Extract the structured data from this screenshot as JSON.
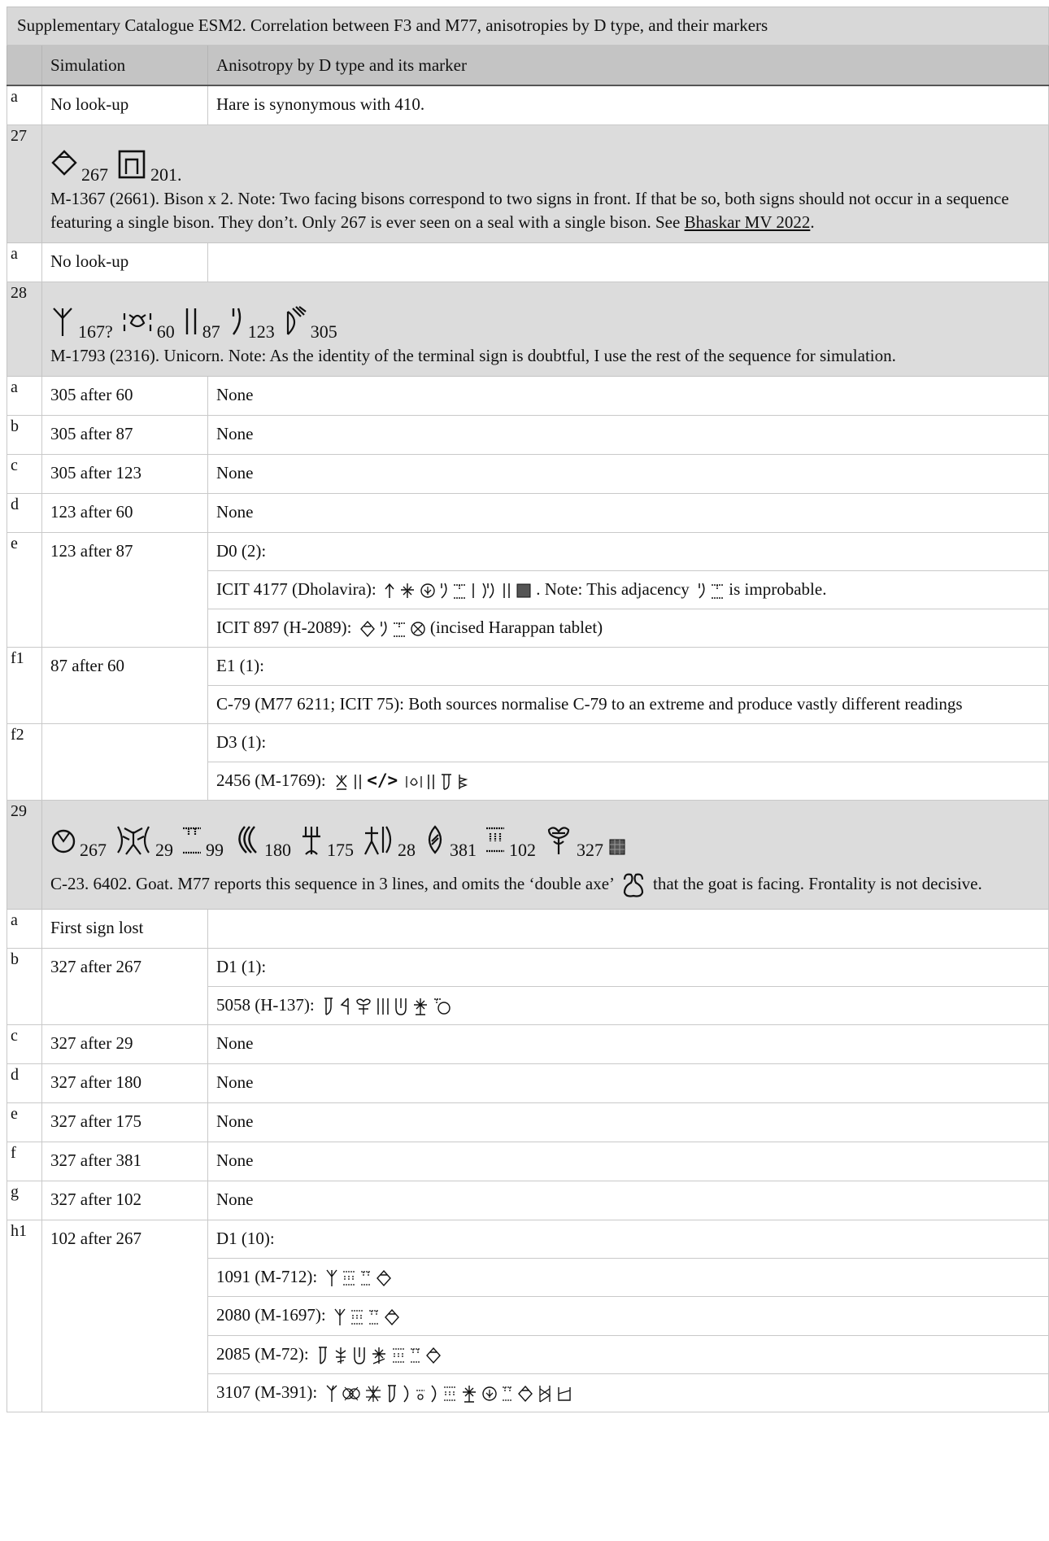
{
  "caption": "Supplementary Catalogue ESM2. Correlation between F3 and M77, anisotropies by D type, and their markers",
  "header": {
    "col1": "",
    "col2": "Simulation",
    "col3": "Anisotropy by D type and its marker"
  },
  "rows": {
    "r1": {
      "label": "a",
      "sim": "No look-up",
      "aniso": "Hare is synonymous with 410."
    },
    "s27": {
      "label": "27",
      "signs": [
        {
          "icon": "diamond-sign-icon",
          "num": "267"
        },
        {
          "icon": "square-sign-icon",
          "num": "201."
        }
      ],
      "note_pre": "M-1367 (2661). Bison x 2. Note: Two facing bisons correspond to two signs in front. If that be so, both signs should not occur in a sequence featuring a single bison. They don’t. Only 267 is ever seen on a seal with a single bison. See ",
      "note_link": "Bhaskar MV 2022",
      "note_post": "."
    },
    "r27a": {
      "label": "a",
      "sim": "No look-up",
      "aniso": ""
    },
    "s28": {
      "label": "28",
      "signs": [
        {
          "icon": "trident-sign-icon",
          "num": "167?"
        },
        {
          "icon": "crab-sign-icon",
          "num": "60"
        },
        {
          "icon": "double-stroke-sign-icon",
          "num": "87"
        },
        {
          "icon": "bracket-sign-icon",
          "num": "123"
        },
        {
          "icon": "bow-sign-icon",
          "num": "305"
        }
      ],
      "note": "M-1793 (2316). Unicorn. Note: As the identity of the terminal sign is doubtful, I use the rest of the sequence for simulation."
    },
    "r28a": {
      "label": "a",
      "sim": "305 after 60",
      "aniso": "None"
    },
    "r28b": {
      "label": "b",
      "sim": "305 after 87",
      "aniso": "None"
    },
    "r28c": {
      "label": "c",
      "sim": "305 after 123",
      "aniso": "None"
    },
    "r28d": {
      "label": "d",
      "sim": "123 after 60",
      "aniso": "None"
    },
    "r28e": {
      "label": "e",
      "sim": "123 after 87",
      "aniso": "D0 (2):",
      "sub1_pre": "ICIT 4177 (Dholavira):",
      "sub1_mid": ". Note: This adjacency",
      "sub1_post": "is improbable.",
      "sub2_pre": "ICIT 897 (H-2089):",
      "sub2_post": "(incised Harappan tablet)"
    },
    "r28f1": {
      "label": "f1",
      "sim": "87 after 60",
      "aniso": "E1 (1):",
      "sub1": "C-79 (M77 6211; ICIT 75): Both sources normalise C-79 to an extreme and produce vastly different readings"
    },
    "r28f2": {
      "label": "f2",
      "sim": "",
      "aniso": "D3 (1):",
      "sub1_pre": "2456 (M-1769):",
      "sub1_code": "</>"
    },
    "s29": {
      "label": "29",
      "signs": [
        {
          "icon": "jar-sign-icon",
          "num": "267"
        },
        {
          "icon": "double-man-sign-icon",
          "num": "29"
        },
        {
          "icon": "dotted-stroke-sign-icon",
          "num": "99"
        },
        {
          "icon": "wave-sign-icon",
          "num": "180"
        },
        {
          "icon": "fork-sign-icon",
          "num": "175"
        },
        {
          "icon": "man-pole-sign-icon",
          "num": "28"
        },
        {
          "icon": "seed-sign-icon",
          "num": "381"
        },
        {
          "icon": "triple-stroke-sign-icon",
          "num": "102"
        },
        {
          "icon": "tree-sign-icon",
          "num": "327"
        }
      ],
      "note_pre": "C-23. 6402. Goat. M77 reports this sequence in 3 lines, and omits the ‘double axe’",
      "note_post": "that the goat is facing. Frontality is not decisive."
    },
    "r29a": {
      "label": "a",
      "sim": "First sign lost",
      "aniso": ""
    },
    "r29b": {
      "label": "b",
      "sim": "327 after 267",
      "aniso": "D1 (1):",
      "sub1_pre": "5058 (H-137):"
    },
    "r29c": {
      "label": "c",
      "sim": "327 after 29",
      "aniso": "None"
    },
    "r29d": {
      "label": "d",
      "sim": "327 after 180",
      "aniso": "None"
    },
    "r29e": {
      "label": "e",
      "sim": "327 after 175",
      "aniso": "None"
    },
    "r29f": {
      "label": "f",
      "sim": "327 after 381",
      "aniso": "None"
    },
    "r29g": {
      "label": "g",
      "sim": "327 after 102",
      "aniso": "None"
    },
    "r29h1": {
      "label": "h1",
      "sim": "102 after 267",
      "aniso": "D1 (10):",
      "sub": [
        "1091 (M-712):",
        "2080 (M-1697):",
        "2085 (M-72):",
        "3107 (M-391):"
      ]
    }
  }
}
